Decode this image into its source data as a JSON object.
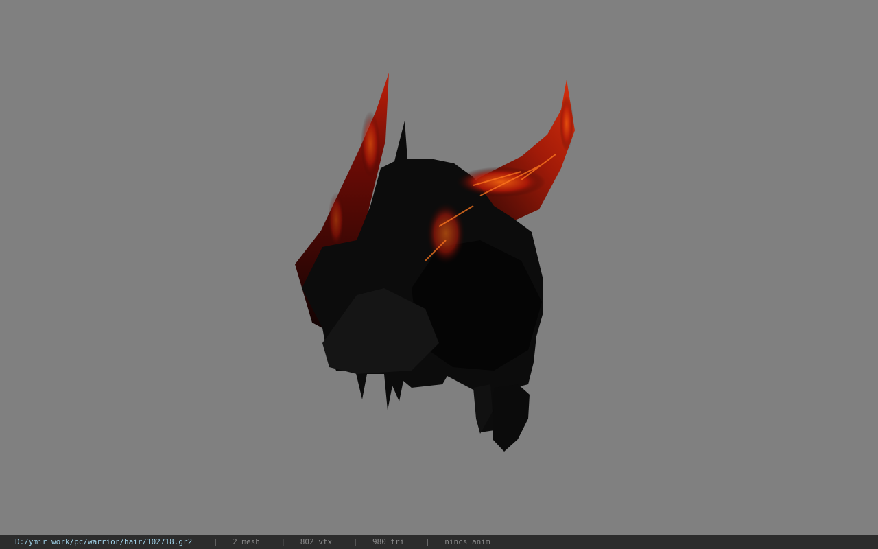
{
  "statusbar": {
    "file_path": "D:/ymir work/pc/warrior/hair/102718.gr2",
    "separator": "|",
    "mesh": "2 mesh",
    "vertices": "802 vtx",
    "triangles": "980 tri",
    "anim": "nincs anim"
  },
  "colors": {
    "viewport_bg": "#808080",
    "statusbar_bg": "#2c2c2c",
    "path_text": "#9fd0e6",
    "info_text": "#8a8a8a"
  }
}
